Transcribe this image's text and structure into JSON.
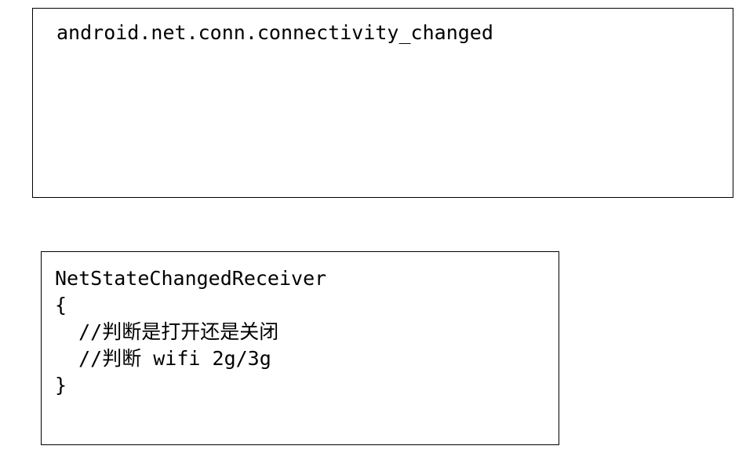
{
  "top_box": {
    "text": "android.net.conn.connectivity_changed"
  },
  "bottom_box": {
    "lines": [
      "NetStateChangedReceiver",
      "{",
      "  //判断是打开还是关闭",
      "  //判断 wifi 2g/3g",
      "}"
    ]
  }
}
